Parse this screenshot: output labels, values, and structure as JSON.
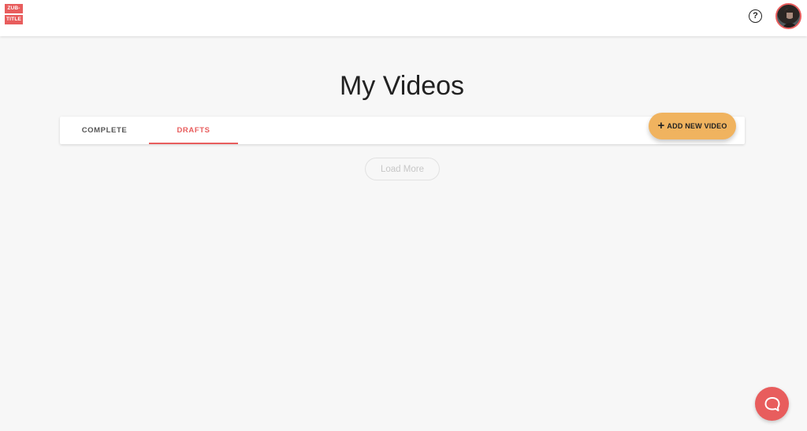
{
  "header": {
    "logo_line1": "ZUB-",
    "logo_line2": "TITLE",
    "help_icon": "question-circle-icon",
    "avatar_icon": "user-avatar"
  },
  "main": {
    "title": "My Videos",
    "tabs": [
      {
        "label": "COMPLETE",
        "active": false
      },
      {
        "label": "DRAFTS",
        "active": true
      }
    ],
    "add_button_label": "ADD NEW VIDEO",
    "add_button_icon": "plus-icon",
    "load_more_label": "Load More"
  },
  "chat": {
    "icon": "chat-bubble-icon"
  },
  "colors": {
    "accent": "#e85d5d",
    "add_button": "#f0b35f",
    "background": "#f7f7f7"
  }
}
